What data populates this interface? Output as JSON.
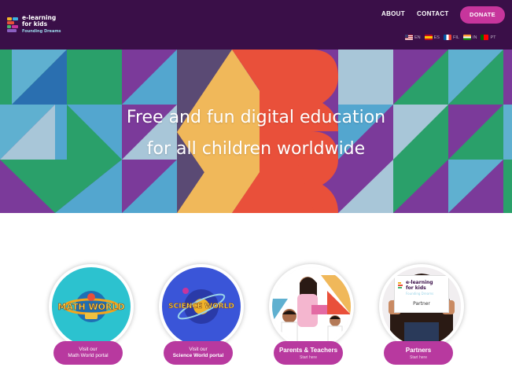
{
  "header": {
    "logo": {
      "line1": "e-learning",
      "line2": "for kids",
      "sub": "Founding Dreams"
    },
    "nav": [
      {
        "label": "ABOUT"
      },
      {
        "label": "CONTACT"
      }
    ],
    "donate_label": "DONATE",
    "languages": [
      {
        "code": "EN",
        "flag": "us-flag-icon"
      },
      {
        "code": "ES",
        "flag": "spain-flag-icon"
      },
      {
        "code": "FIL",
        "flag": "france-flag-icon"
      },
      {
        "code": "IN",
        "flag": "india-flag-icon"
      },
      {
        "code": "PT",
        "flag": "portugal-flag-icon"
      }
    ]
  },
  "hero": {
    "line1": "Free and fun digital education",
    "line2": "for all children worldwide"
  },
  "cards": [
    {
      "art_text": "MATH WORLD",
      "line1": "Visit our",
      "line2": "Math World portal"
    },
    {
      "art_text": "SCIENCE WORLD",
      "line1": "Visit our",
      "line2": "Science World portal"
    },
    {
      "line1": "Parents & Teachers",
      "line2": "Start here"
    },
    {
      "line1": "Partners",
      "line2": "Start here",
      "sign_line1": "e-learning",
      "sign_line2": "for kids",
      "sign_sub": "Founding Dreams",
      "sign_label": "Partner"
    }
  ],
  "colors": {
    "header_bg": "#3a0f48",
    "accent": "#c7359c",
    "pill": "#b8399f"
  }
}
